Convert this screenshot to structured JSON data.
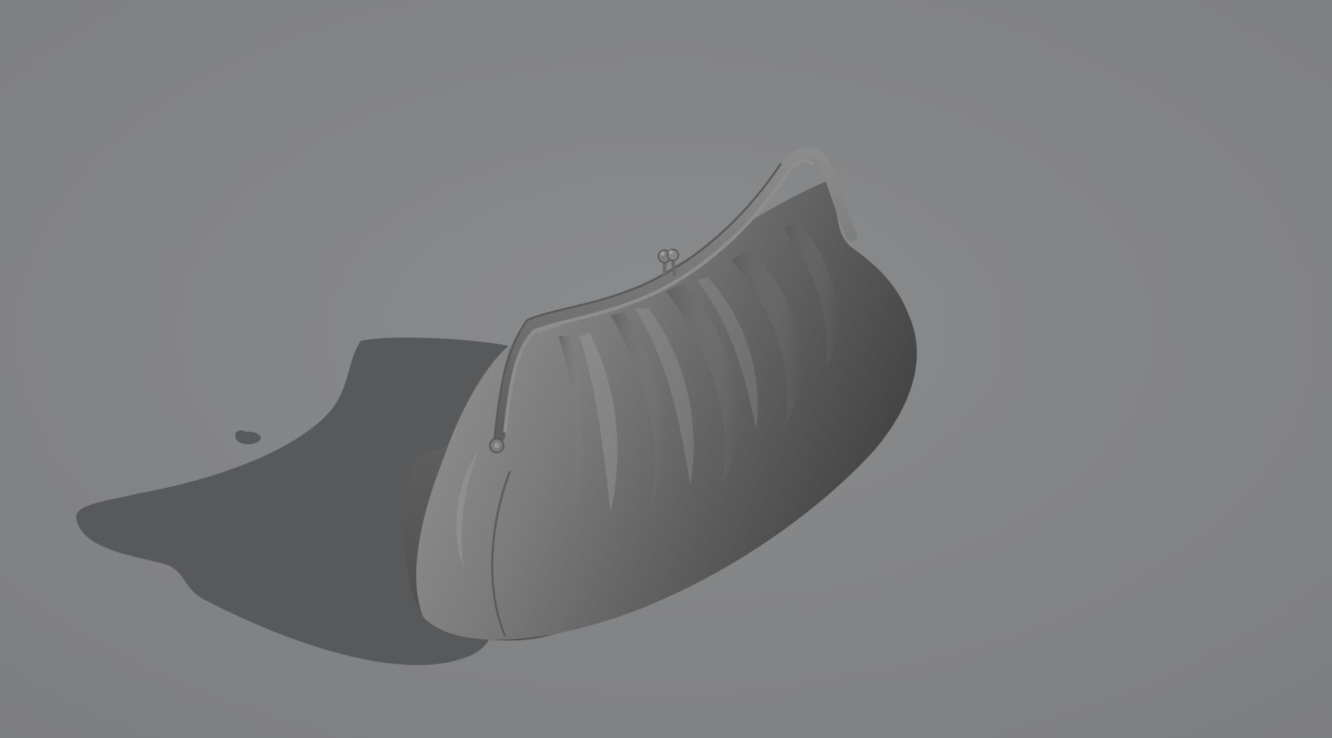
{
  "scene": {
    "subject": "clutch-purse-render",
    "colors": {
      "background": "#808183",
      "background_light": "#8a8b8d",
      "shadow": "#57585a",
      "body_light": "#8d8d8d",
      "body_mid": "#6e6e6e",
      "body_dark": "#4a4a4a",
      "frame": "#6a6a6a",
      "frame_highlight": "#9a9a9a",
      "clasp": "#7a7a7a"
    }
  }
}
